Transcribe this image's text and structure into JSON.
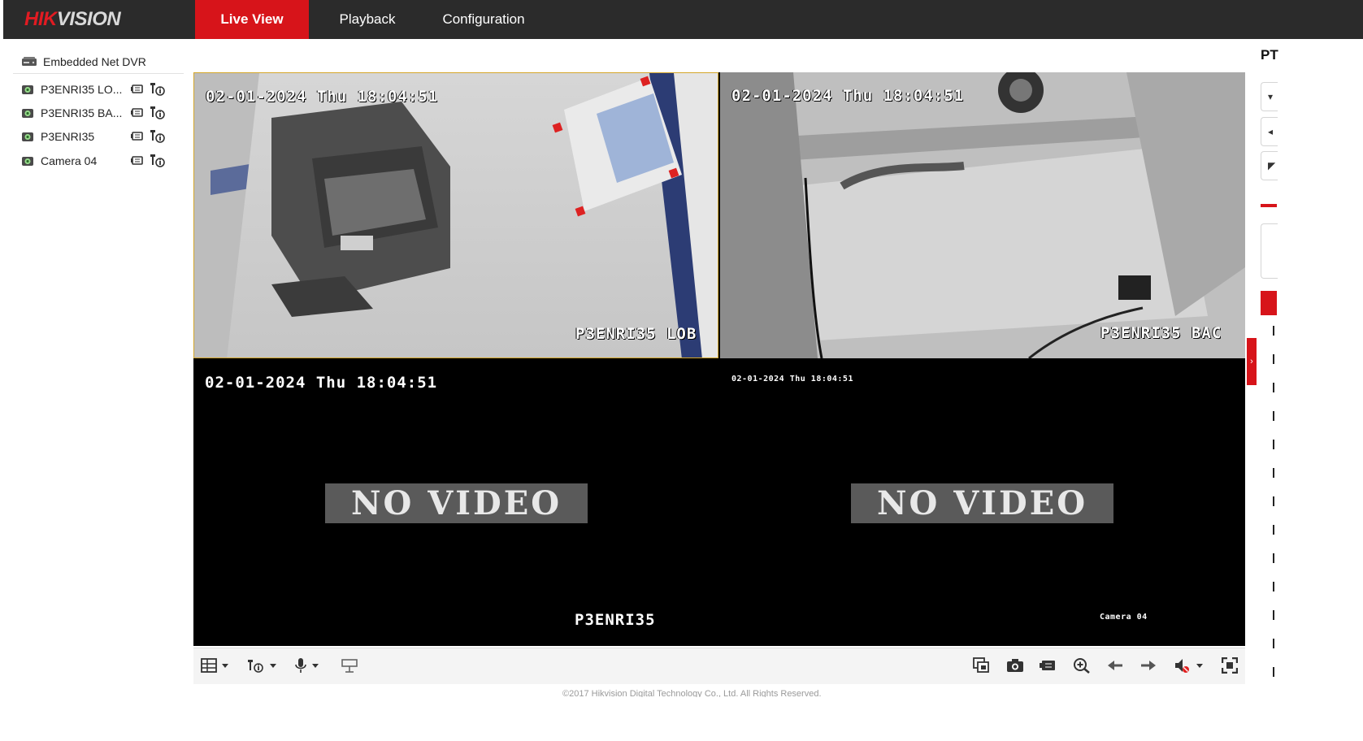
{
  "brand": {
    "logo_red": "HIK",
    "logo_white": "VISION"
  },
  "nav": {
    "tabs": [
      {
        "label": "Live View",
        "active": true
      },
      {
        "label": "Playback",
        "active": false
      },
      {
        "label": "Configuration",
        "active": false
      }
    ]
  },
  "device_tree": {
    "root_label": "Embedded Net DVR",
    "cameras": [
      {
        "label": "P3ENRI35 LO..."
      },
      {
        "label": "P3ENRI35 BA..."
      },
      {
        "label": "P3ENRI35"
      },
      {
        "label": "Camera 04"
      }
    ]
  },
  "panes": [
    {
      "timestamp": "02-01-2024 Thu 18:04:51",
      "camera_label": "P3ENRI35 LOB",
      "no_video": ""
    },
    {
      "timestamp": "02-01-2024 Thu 18:04:51",
      "camera_label": "P3ENRI35 BAC",
      "no_video": ""
    },
    {
      "timestamp": "02-01-2024 Thu 18:04:51",
      "camera_label": "P3ENRI35",
      "no_video": "NO VIDEO"
    },
    {
      "timestamp": "02-01-2024 Thu 18:04:51",
      "camera_label": "Camera 04",
      "no_video": "NO VIDEO"
    }
  ],
  "ptz": {
    "title_fragment": "PT"
  },
  "footer": {
    "copyright": "©2017 Hikvision Digital Technology Co., Ltd. All Rights Reserved."
  },
  "colors": {
    "accent": "#d7141a",
    "topbar": "#2b2b2b",
    "selected_pane_border": "#d4a62a"
  }
}
